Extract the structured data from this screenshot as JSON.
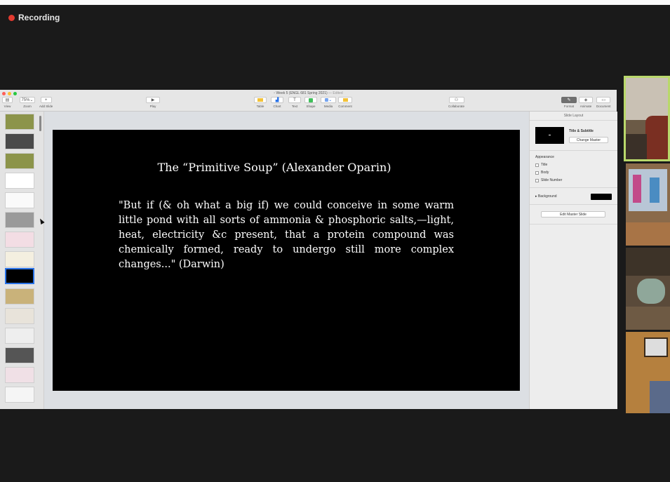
{
  "recording": {
    "label": "Recording",
    "dot_color": "#e23a2f"
  },
  "window": {
    "title": "Week 5 (ENGL 681 Spring 2021)",
    "title_status": "— Edited",
    "toolbar": {
      "view": "View",
      "zoom_value": "75%",
      "zoom": "Zoom",
      "add_slide": "Add Slide",
      "play": "Play",
      "table": "Table",
      "chart": "Chart",
      "text": "Text",
      "shape": "Shape",
      "media": "Media",
      "comment": "Comment",
      "collaborate": "Collaborate",
      "format": "Format",
      "animate": "Animate",
      "document": "Document"
    }
  },
  "slide": {
    "title": "The “Primitive Soup” (Alexander Oparin)",
    "body": "\"But if (& oh what a big if) we could conceive in some warm little pond with all sorts of ammonia & phosphoric salts,—light, heat, electricity &c present, that a protein compound was chemically formed, ready to undergo still more complex changes...\" (Darwin)"
  },
  "inspector": {
    "header": "Slide Layout",
    "layout_name": "Title & Subtitle",
    "change_master": "Change Master",
    "appearance": "Appearance",
    "title_opt": "Title",
    "body_opt": "Body",
    "slide_number_opt": "Slide Number",
    "background": "Background",
    "background_color": "#000000",
    "edit_master": "Edit Master Slide"
  },
  "navigator": {
    "selected_index": 9
  },
  "colors": {
    "accent": "#2a73e8",
    "olive_slide": "#8c944a"
  }
}
